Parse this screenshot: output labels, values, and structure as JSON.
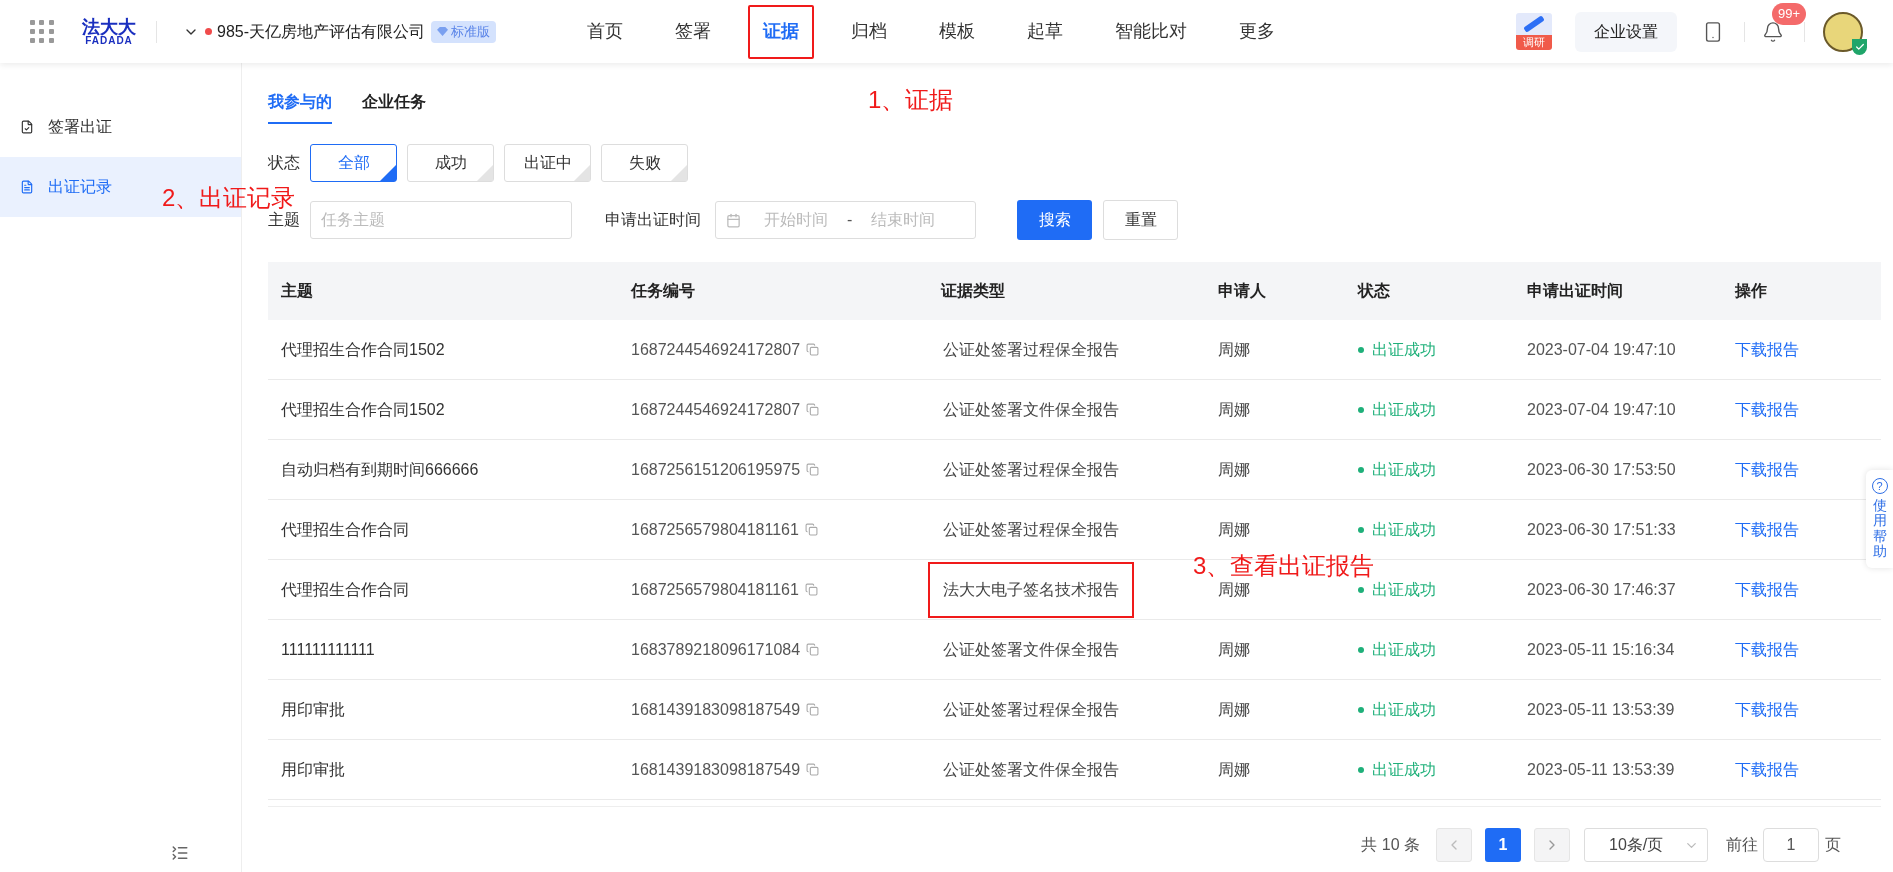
{
  "header": {
    "logo_cn": "法大大",
    "logo_en": "FADADA",
    "company": "985-天亿房地产评估有限公司",
    "edition": "标准版",
    "nav": [
      {
        "label": "首页",
        "selected": false,
        "highlighted": false
      },
      {
        "label": "签署",
        "selected": false,
        "highlighted": false
      },
      {
        "label": "证据",
        "selected": true,
        "highlighted": true
      },
      {
        "label": "归档",
        "selected": false,
        "highlighted": false
      },
      {
        "label": "模板",
        "selected": false,
        "highlighted": false
      },
      {
        "label": "起草",
        "selected": false,
        "highlighted": false
      },
      {
        "label": "智能比对",
        "selected": false,
        "highlighted": false
      },
      {
        "label": "更多",
        "selected": false,
        "highlighted": false
      }
    ],
    "survey_label": "调研",
    "settings_button": "企业设置",
    "notification_badge": "99+"
  },
  "sidebar": {
    "items": [
      {
        "label": "签署出证",
        "selected": false
      },
      {
        "label": "出证记录",
        "selected": true
      }
    ]
  },
  "tabs": [
    {
      "label": "我参与的",
      "selected": true
    },
    {
      "label": "企业任务",
      "selected": false
    }
  ],
  "filters": {
    "status_label": "状态",
    "statuses": [
      {
        "label": "全部",
        "selected": true
      },
      {
        "label": "成功",
        "selected": false
      },
      {
        "label": "出证中",
        "selected": false
      },
      {
        "label": "失败",
        "selected": false
      }
    ],
    "subject_label": "主题",
    "subject_placeholder": "任务主题",
    "date_label": "申请出证时间",
    "start_placeholder": "开始时间",
    "separator": "-",
    "end_placeholder": "结束时间",
    "search_button": "搜索",
    "reset_button": "重置"
  },
  "table": {
    "columns": [
      "主题",
      "任务编号",
      "证据类型",
      "申请人",
      "状态",
      "申请出证时间",
      "操作"
    ],
    "rows": [
      {
        "subject": "代理招生合作合同1502",
        "task_no": "1687244546924172807",
        "type": "公证处签署过程保全报告",
        "type_highlighted": false,
        "applicant": "周娜",
        "status": "出证成功",
        "color": "#1fb07a",
        "time": "2023-07-04 19:47:10",
        "action": "下载报告"
      },
      {
        "subject": "代理招生合作合同1502",
        "task_no": "1687244546924172807",
        "type": "公证处签署文件保全报告",
        "type_highlighted": false,
        "applicant": "周娜",
        "status": "出证成功",
        "color": "#1fb07a",
        "time": "2023-07-04 19:47:10",
        "action": "下载报告"
      },
      {
        "subject": "自动归档有到期时间666666",
        "task_no": "1687256151206195975",
        "type": "公证处签署过程保全报告",
        "type_highlighted": false,
        "applicant": "周娜",
        "status": "出证成功",
        "color": "#1fb07a",
        "time": "2023-06-30 17:53:50",
        "action": "下载报告"
      },
      {
        "subject": "代理招生合作合同",
        "task_no": "1687256579804181161",
        "type": "公证处签署过程保全报告",
        "type_highlighted": false,
        "applicant": "周娜",
        "status": "出证成功",
        "color": "#1fb07a",
        "time": "2023-06-30 17:51:33",
        "action": "下载报告"
      },
      {
        "subject": "代理招生合作合同",
        "task_no": "1687256579804181161",
        "type": "法大大电子签名技术报告",
        "type_highlighted": true,
        "applicant": "周娜",
        "status": "出证成功",
        "color": "#1fb07a",
        "time": "2023-06-30 17:46:37",
        "action": "下载报告"
      },
      {
        "subject": "111111111111",
        "task_no": "1683789218096171084",
        "type": "公证处签署文件保全报告",
        "type_highlighted": false,
        "applicant": "周娜",
        "status": "出证成功",
        "color": "#1fb07a",
        "time": "2023-05-11 15:16:34",
        "action": "下载报告"
      },
      {
        "subject": "用印审批",
        "task_no": "1681439183098187549",
        "type": "公证处签署过程保全报告",
        "type_highlighted": false,
        "applicant": "周娜",
        "status": "出证成功",
        "color": "#1fb07a",
        "time": "2023-05-11 13:53:39",
        "action": "下载报告"
      },
      {
        "subject": "用印审批",
        "task_no": "1681439183098187549",
        "type": "公证处签署文件保全报告",
        "type_highlighted": false,
        "applicant": "周娜",
        "status": "出证成功",
        "color": "#1fb07a",
        "time": "2023-05-11 13:53:39",
        "action": "下载报告"
      }
    ]
  },
  "pagination": {
    "total": "共 10 条",
    "pages": [
      {
        "label": "1",
        "selected": true
      }
    ],
    "page_size": "10条/页",
    "goto_label": "前往",
    "goto_value": "1",
    "goto_suffix": "页"
  },
  "help": {
    "icon": "?",
    "label": "使用帮助"
  },
  "annotations": [
    {
      "text": "1、证据"
    },
    {
      "text": "2、出证记录"
    },
    {
      "text": "3、查看出证报告"
    }
  ]
}
